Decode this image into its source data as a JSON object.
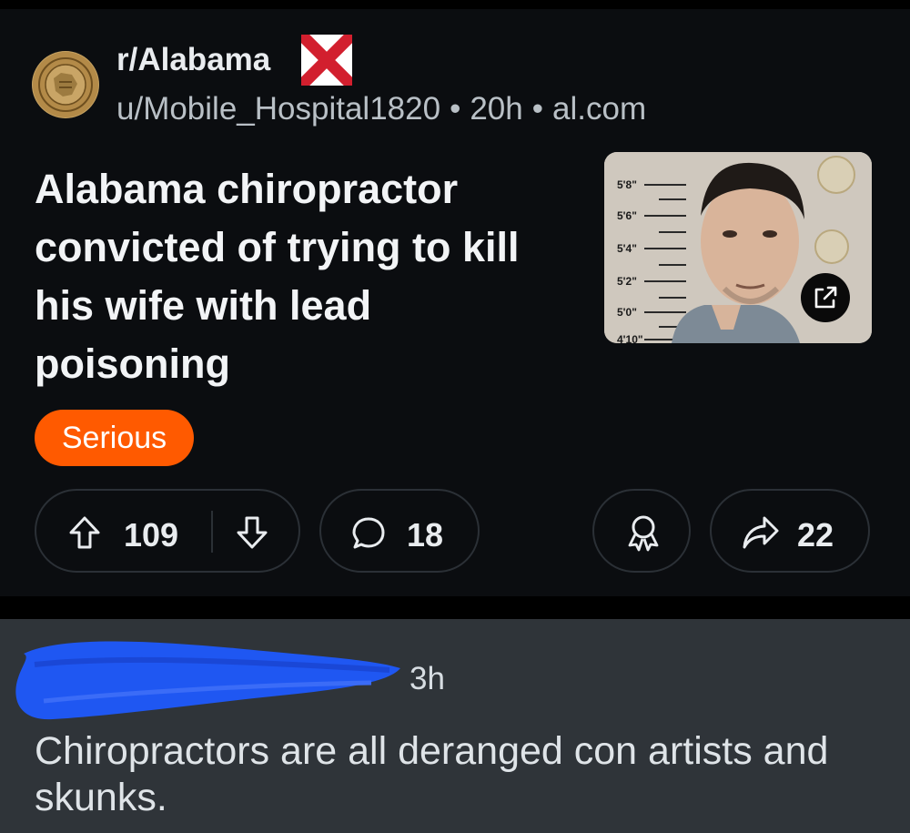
{
  "post": {
    "subreddit": "r/Alabama",
    "author": "u/Mobile_Hospital1820",
    "separator": "•",
    "age": "20h",
    "domain": "al.com",
    "title": "Alabama chiropractor convicted of trying to kill his wife with lead poisoning",
    "flair": "Serious",
    "flair_color": "#ff5a00",
    "thumbnail_height_marks": [
      "5'8\"",
      "5'6\"",
      "5'4\"",
      "5'2\"",
      "5'0\"",
      "4'10\""
    ],
    "thumbnail_icon": "external-link-icon",
    "upvotes": "109",
    "comments": "18",
    "shares": "22",
    "icons": [
      "upvote-arrow-icon",
      "downvote-arrow-icon",
      "comment-bubble-icon",
      "award-icon",
      "share-arrow-icon"
    ]
  },
  "comment": {
    "age": "3h",
    "text": "Chiropractors are all deranged con artists and skunks."
  },
  "colors": {
    "background": "#0b0d10",
    "comment_bg": "#2f3439",
    "redaction": "#1f57f2"
  }
}
